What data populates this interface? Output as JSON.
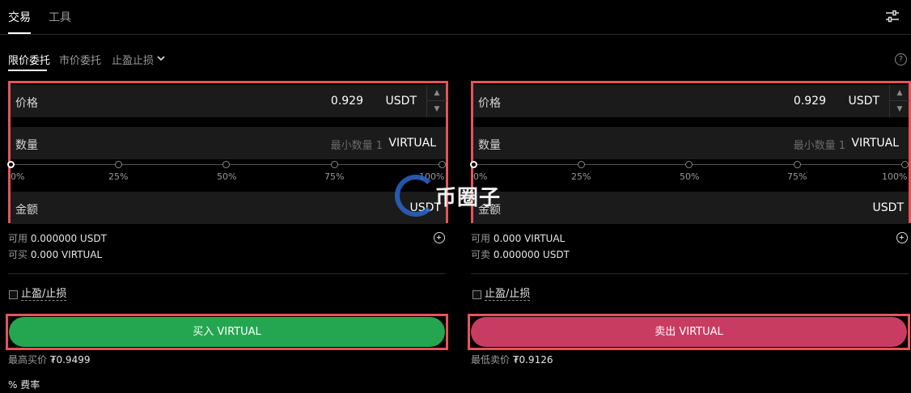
{
  "top_tabs": {
    "trade": "交易",
    "tools": "工具"
  },
  "order_tabs": {
    "limit": "限价委托",
    "market": "市价委托",
    "tpsl": "止盈止损"
  },
  "help": "?",
  "buy": {
    "price_label": "价格",
    "price_value": "0.929",
    "price_unit": "USDT",
    "qty_label": "数量",
    "qty_placeholder": "最小数量 1",
    "qty_unit": "VIRTUAL",
    "slider_ticks": [
      "0%",
      "25%",
      "50%",
      "75%",
      "100%"
    ],
    "slider_value_percent": 0,
    "amount_label": "金额",
    "amount_unit": "USDT",
    "available_label": "可用",
    "available_value": "0.000000 USDT",
    "can_label": "可买",
    "can_value": "0.000 VIRTUAL",
    "tpsl_label": "止盈/止损",
    "button": "买入 VIRTUAL",
    "best_price_label": "最高买价",
    "best_price_value": "₮0.9499"
  },
  "sell": {
    "price_label": "价格",
    "price_value": "0.929",
    "price_unit": "USDT",
    "qty_label": "数量",
    "qty_placeholder": "最小数量 1",
    "qty_unit": "VIRTUAL",
    "slider_ticks": [
      "0%",
      "25%",
      "50%",
      "75%",
      "100%"
    ],
    "slider_value_percent": 0,
    "amount_label": "金额",
    "amount_unit": "USDT",
    "available_label": "可用",
    "available_value": "0.000 VIRTUAL",
    "can_label": "可卖",
    "can_value": "0.000000 USDT",
    "tpsl_label": "止盈/止损",
    "button": "卖出 VIRTUAL",
    "best_price_label": "最低卖价",
    "best_price_value": "₮0.9126"
  },
  "fee_label": "费率",
  "fee_icon": "%",
  "watermark": "币圈子",
  "colors": {
    "buy": "#24a650",
    "sell": "#c83c62",
    "highlight": "#e5545a"
  }
}
